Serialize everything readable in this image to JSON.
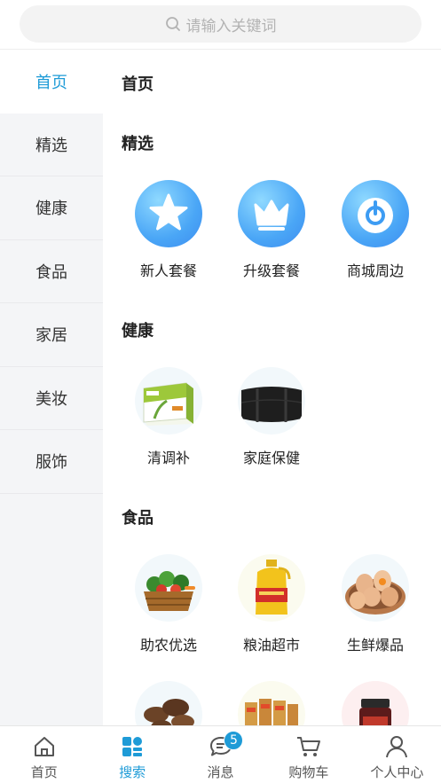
{
  "search": {
    "placeholder": "请输入关键词"
  },
  "sidebar": {
    "items": [
      {
        "label": "首页",
        "active": true
      },
      {
        "label": "精选"
      },
      {
        "label": "健康"
      },
      {
        "label": "食品"
      },
      {
        "label": "家居"
      },
      {
        "label": "美妆"
      },
      {
        "label": "服饰"
      }
    ]
  },
  "content": {
    "page_title": "首页",
    "sections": [
      {
        "title": "精选",
        "items": [
          {
            "label": "新人套餐",
            "icon": "star-icon"
          },
          {
            "label": "升级套餐",
            "icon": "crown-icon"
          },
          {
            "label": "商城周边",
            "icon": "power-icon"
          }
        ]
      },
      {
        "title": "健康",
        "items": [
          {
            "label": "清调补",
            "icon": "supplement-box-image"
          },
          {
            "label": "家庭保健",
            "icon": "waist-belt-image"
          }
        ]
      },
      {
        "title": "食品",
        "items": [
          {
            "label": "助农优选",
            "icon": "vegetable-basket-image"
          },
          {
            "label": "粮油超市",
            "icon": "oil-bottle-image"
          },
          {
            "label": "生鲜爆品",
            "icon": "eggs-image"
          }
        ]
      }
    ]
  },
  "tabbar": {
    "items": [
      {
        "label": "首页",
        "icon": "home-icon"
      },
      {
        "label": "搜索",
        "icon": "grid-search-icon",
        "active": true
      },
      {
        "label": "消息",
        "icon": "message-icon",
        "badge": "5"
      },
      {
        "label": "购物车",
        "icon": "cart-icon"
      },
      {
        "label": "个人中心",
        "icon": "user-icon"
      }
    ]
  },
  "colors": {
    "accent": "#1e9bd7",
    "sidebar_bg": "#f4f5f7",
    "search_bg": "#f3f3f3"
  }
}
